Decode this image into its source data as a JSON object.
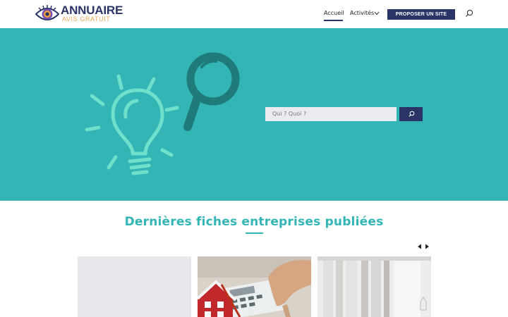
{
  "header": {
    "logo": {
      "title": "ANNUAIRE",
      "subtitle": "AVIS GRATUIT"
    },
    "nav": {
      "home_label": "Accueil",
      "activities_label": "Activités",
      "propose_label": "PROPOSER UN SITE"
    },
    "icons": [
      "eye-logo-icon",
      "chevron-down-icon",
      "search-icon"
    ]
  },
  "hero": {
    "search_placeholder": "Qui ? Quoi ?",
    "illustration": [
      "lightbulb-icon",
      "magnifier-icon"
    ]
  },
  "section": {
    "title": "Dernières fiches entreprises publiées",
    "carousel_icons": [
      "arrow-left-icon",
      "arrow-right-icon"
    ]
  },
  "colors": {
    "teal": "#33b5b5",
    "navy": "#2b3467",
    "bulb": "#6ee0cc",
    "magnifier": "#1f7a7a"
  }
}
